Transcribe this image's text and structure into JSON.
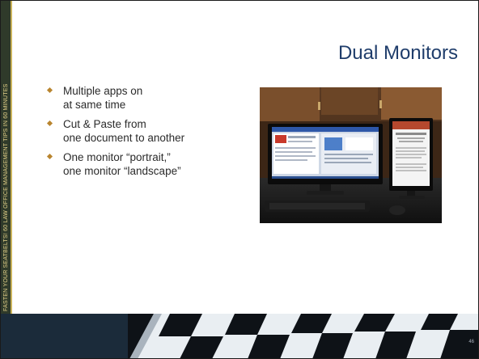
{
  "side_banner": {
    "text": "FASTEN YOUR SEATBELTS! 60 LAW OFFICE MANAGEMENT TIPS IN 60 MINUTES"
  },
  "slide": {
    "title": "Dual Monitors",
    "bullets": [
      {
        "line1": "Multiple apps on",
        "line2": "at same time"
      },
      {
        "line1": "Cut & Paste from",
        "line2": "one document to another"
      },
      {
        "line1": "One monitor “portrait,”",
        "line2": "one monitor “landscape”"
      }
    ]
  },
  "footer": {
    "page_number": "46"
  },
  "colors": {
    "title": "#1f3d6b",
    "bullet": "#b9852f",
    "banner": "#2f3a2a",
    "banner_text": "#e6d38a"
  }
}
